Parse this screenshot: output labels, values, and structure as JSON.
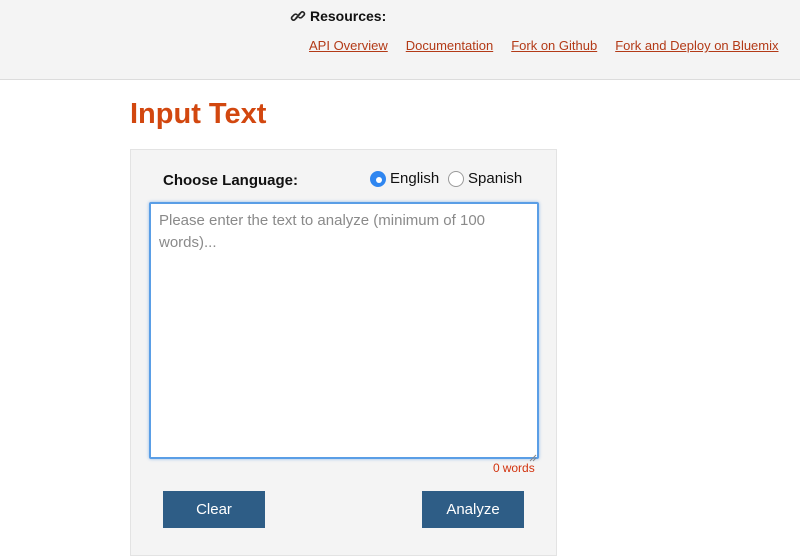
{
  "header": {
    "resources_label": "Resources:",
    "icon": "link-icon",
    "links": [
      {
        "label": "API Overview"
      },
      {
        "label": "Documentation"
      },
      {
        "label": "Fork on Github"
      },
      {
        "label": "Fork and Deploy on Bluemix"
      }
    ]
  },
  "main": {
    "title": "Input Text",
    "language": {
      "label": "Choose Language:",
      "options": [
        {
          "label": "English",
          "checked": true
        },
        {
          "label": "Spanish",
          "checked": false
        }
      ]
    },
    "textarea": {
      "value": "",
      "placeholder": "Please enter the text to analyze (minimum of 100 words)..."
    },
    "word_count": {
      "count": "0",
      "unit": "words"
    },
    "buttons": {
      "clear": "Clear",
      "analyze": "Analyze"
    }
  },
  "colors": {
    "accent": "#d2470f",
    "link": "#b33a17",
    "button": "#2e5d86",
    "radio_checked": "#2f86f0",
    "word_count": "#d2330f"
  }
}
